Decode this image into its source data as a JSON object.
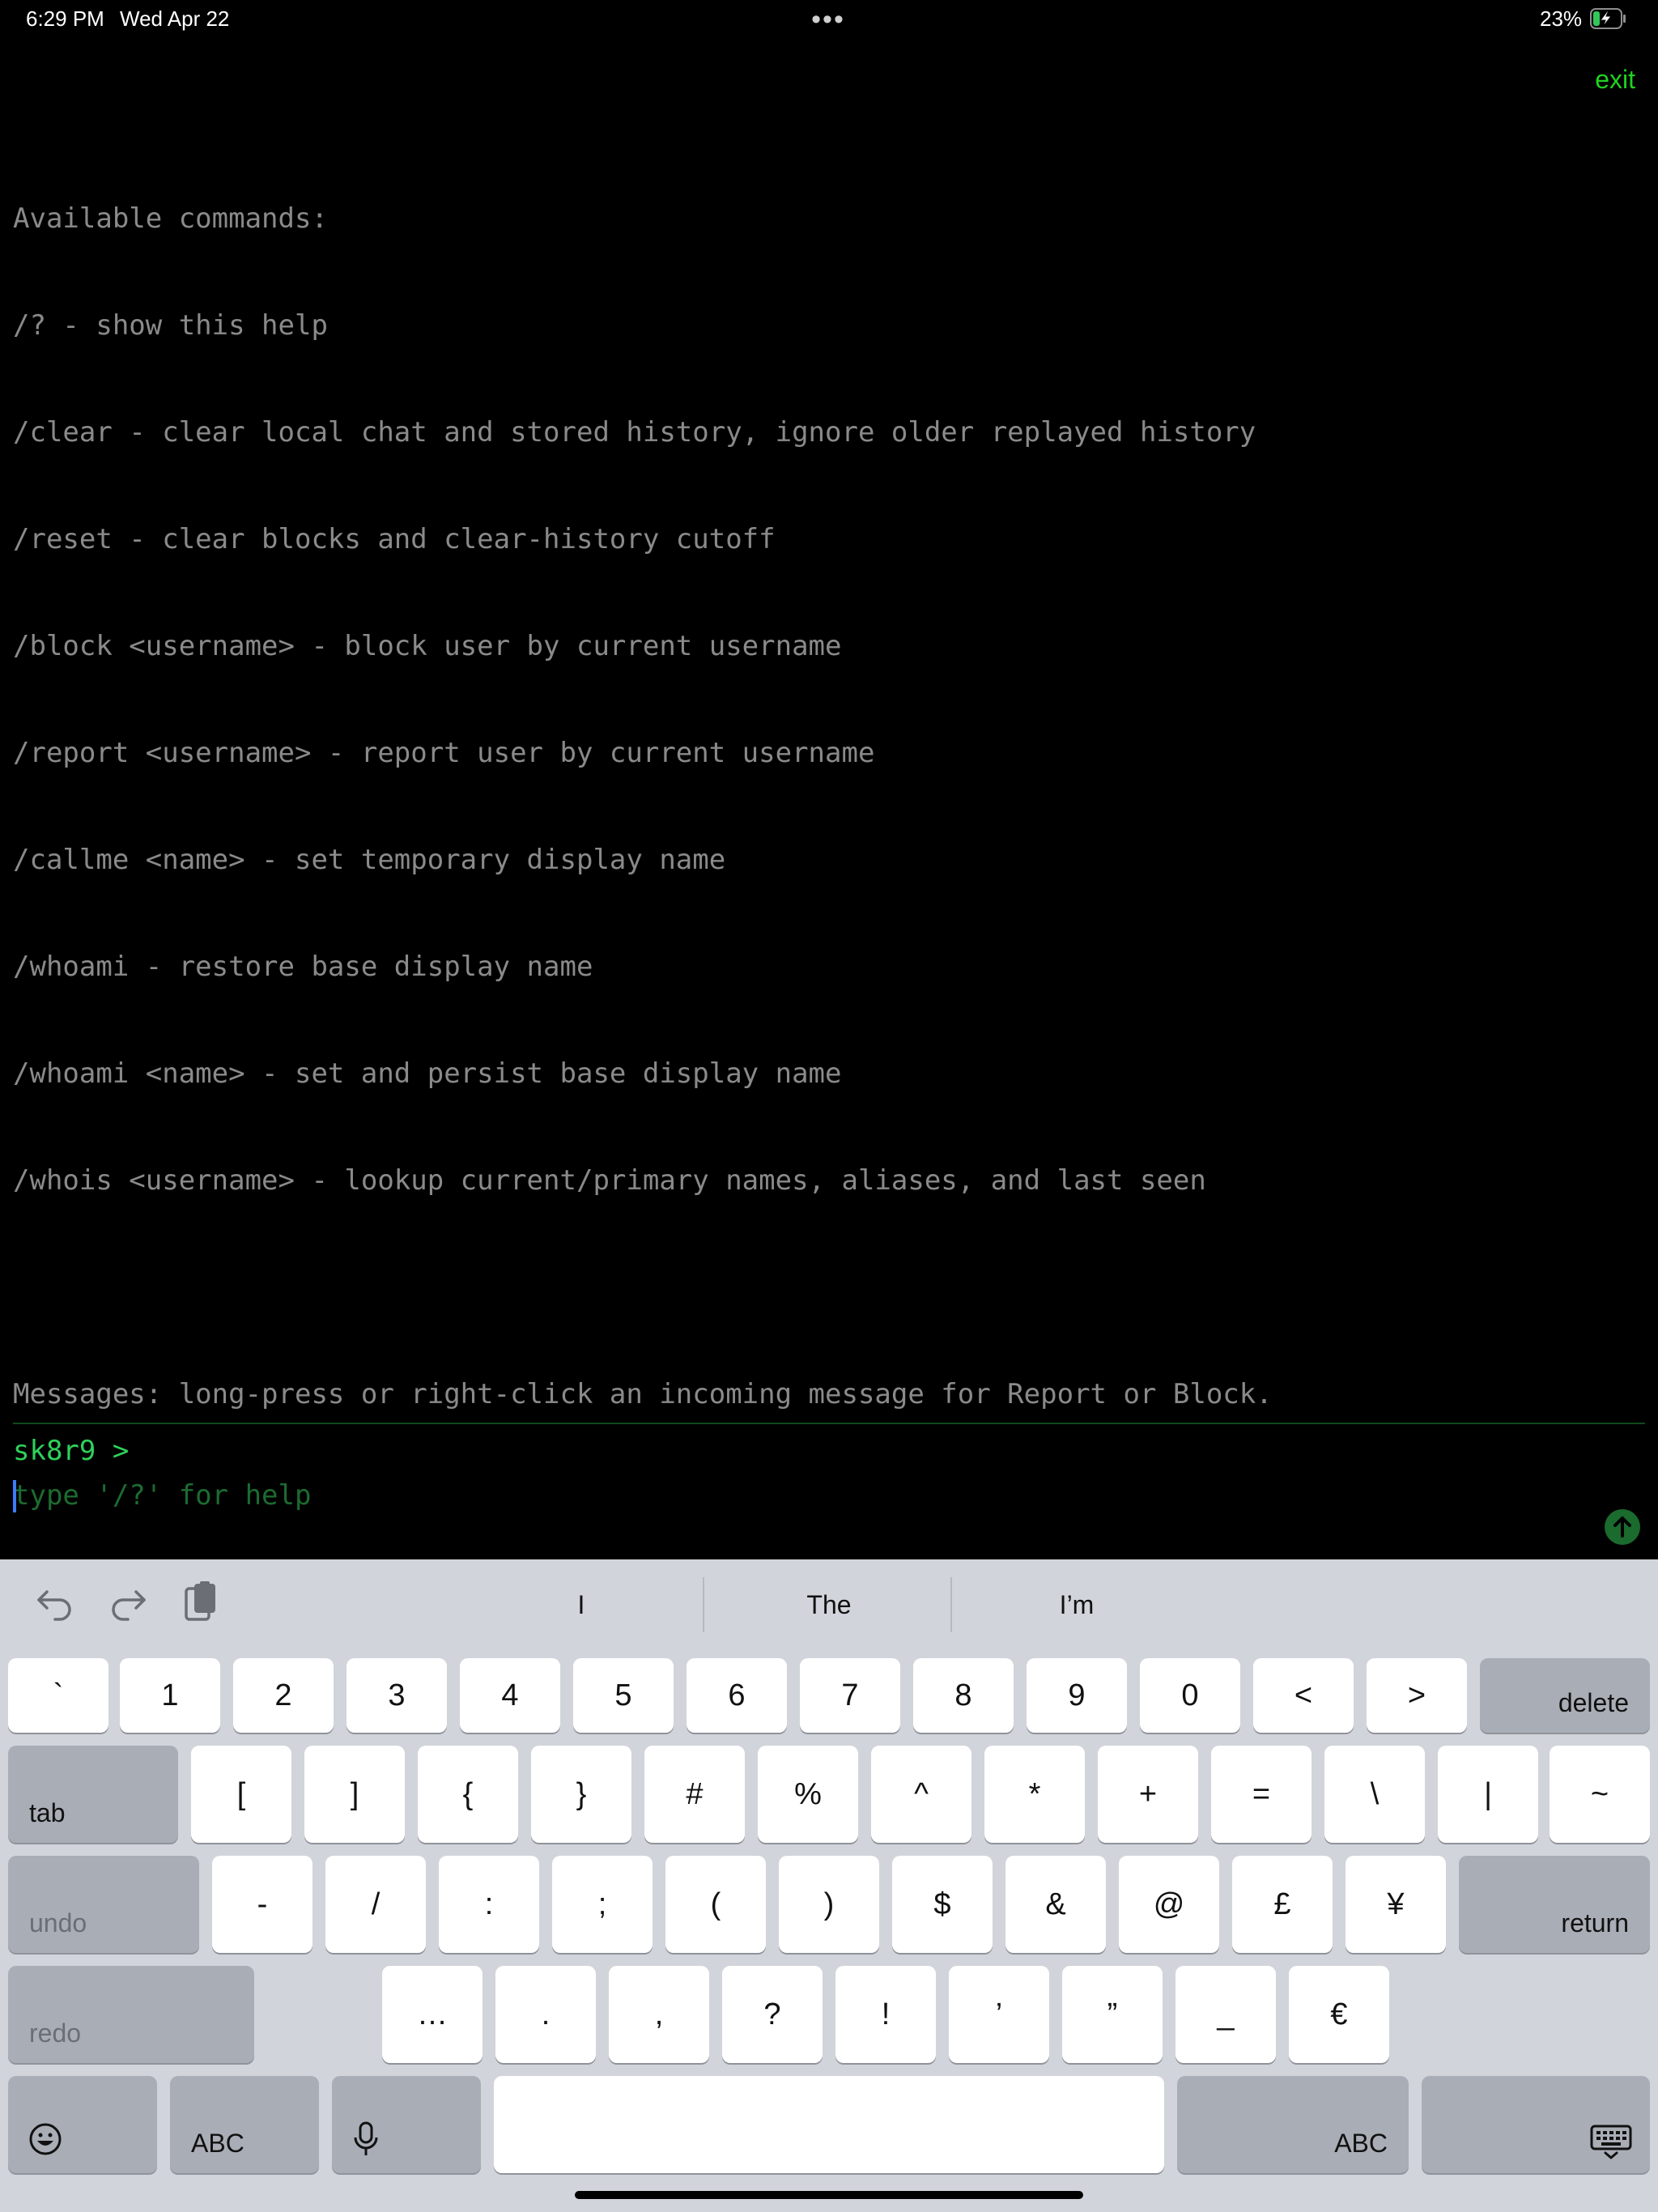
{
  "status_bar": {
    "time": "6:29 PM",
    "date": "Wed Apr 22",
    "battery_percent": "23%",
    "battery_level": 0.23,
    "charging": true
  },
  "terminal": {
    "exit_label": "exit",
    "lines": [
      "Available commands:",
      "/? - show this help",
      "/clear - clear local chat and stored history, ignore older replayed history",
      "/reset - clear blocks and clear-history cutoff",
      "/block <username> - block user by current username",
      "/report <username> - report user by current username",
      "/callme <name> - set temporary display name",
      "/whoami - restore base display name",
      "/whoami <name> - set and persist base display name",
      "/whois <username> - lookup current/primary names, aliases, and last seen",
      "",
      "Messages: long-press or right-click an incoming message for Report or Block."
    ],
    "prompt": "sk8r9 >",
    "input_placeholder": "type '/?' for help",
    "input_value": ""
  },
  "keyboard": {
    "suggestions": [
      "I",
      "The",
      "I’m"
    ],
    "row1": [
      "`",
      "1",
      "2",
      "3",
      "4",
      "5",
      "6",
      "7",
      "8",
      "9",
      "0",
      "<",
      ">"
    ],
    "delete_label": "delete",
    "tab_label": "tab",
    "row2": [
      "[",
      "]",
      "{",
      "}",
      "#",
      "%",
      "^",
      "*",
      "+",
      "=",
      "\\",
      "|",
      "~"
    ],
    "undo_label": "undo",
    "row3": [
      "-",
      "/",
      ":",
      ";",
      "(",
      ")",
      "$",
      "&",
      "@",
      "£",
      "¥"
    ],
    "return_label": "return",
    "redo_label": "redo",
    "row4": [
      "…",
      ".",
      ",",
      "?",
      "!",
      "’",
      "”",
      "_",
      "€"
    ],
    "abc_label_left": "ABC",
    "abc_label_right": "ABC"
  },
  "colors": {
    "accent_green": "#20d11e",
    "prompt_green": "#2fd05a",
    "output_gray": "#8a8a8a"
  }
}
